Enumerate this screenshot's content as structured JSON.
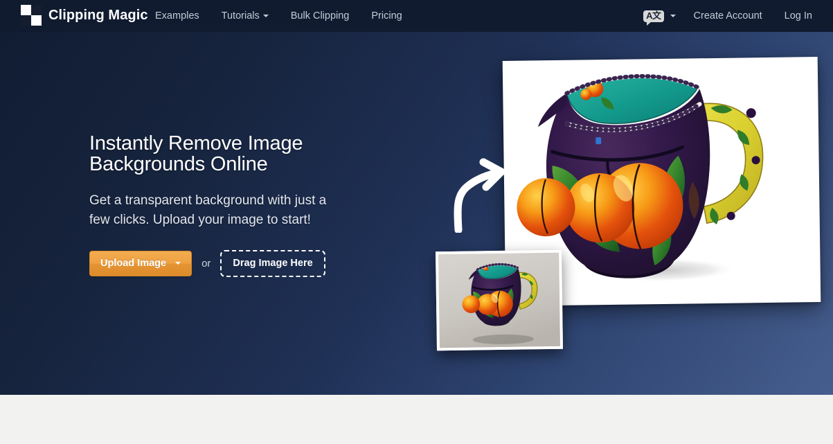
{
  "brand": {
    "name": "Clipping Magic",
    "logo_icon": "checkerboard-transparency-icon"
  },
  "nav": {
    "links": [
      {
        "label": "Examples",
        "has_caret": false
      },
      {
        "label": "Tutorials",
        "has_caret": true
      },
      {
        "label": "Bulk Clipping",
        "has_caret": false
      },
      {
        "label": "Pricing",
        "has_caret": false
      }
    ],
    "language": {
      "icon": "translate-icon",
      "glyph": "A文",
      "has_caret": true
    },
    "create_account": "Create Account",
    "log_in": "Log In"
  },
  "hero": {
    "headline_line1": "Instantly Remove Image",
    "headline_line2": "Backgrounds Online",
    "subcopy": "Get a transparent background with just a few clicks. Upload your image to start!",
    "upload_button": "Upload Image",
    "or": "or",
    "drag_button": "Drag Image Here",
    "before_image_alt": "Ceramic peach pitcher photo with gray background",
    "after_image_alt": "Ceramic peach pitcher with background removed",
    "arrow_icon": "curved-arrow-icon"
  },
  "colors": {
    "navbar": "#101b30",
    "hero_gradient_start": "#111d33",
    "hero_gradient_end": "#465e8e",
    "accent_orange": "#eea141",
    "nav_link": "#c3cbd8",
    "below_fold": "#f2f2f0"
  }
}
